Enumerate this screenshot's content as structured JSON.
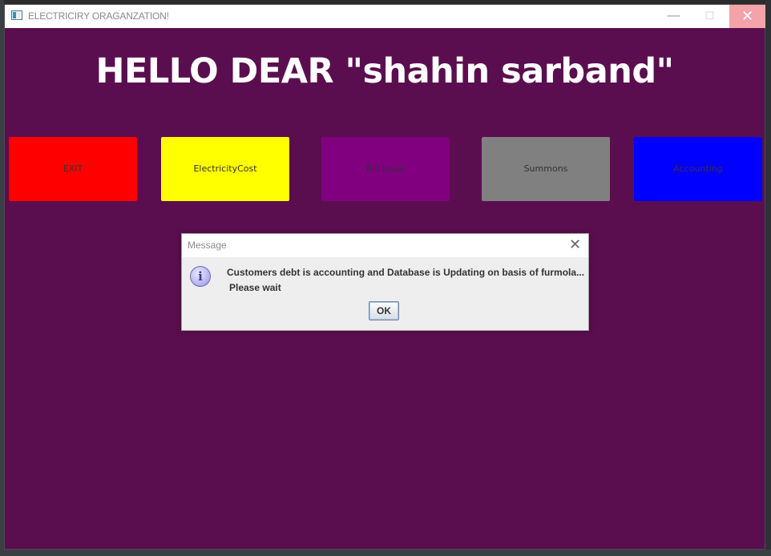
{
  "window": {
    "title": "ELECTRICIRY ORAGANZATION!",
    "controls": {
      "minimize": "—",
      "maximize": "☐",
      "close": "✕"
    }
  },
  "main": {
    "greeting": "HELLO DEAR \"shahin sarband\"",
    "buttons": [
      {
        "label": "EXIT",
        "color": "#ff0000"
      },
      {
        "label": "ElectricityCost",
        "color": "#ffff00"
      },
      {
        "label": "Bill issue",
        "color": "#800080"
      },
      {
        "label": "Summons",
        "color": "#808080"
      },
      {
        "label": "Accounting",
        "color": "#0000ff"
      }
    ]
  },
  "dialog": {
    "title": "Message",
    "icon": "info-icon",
    "message_line1": "Customers debt is accounting and Database is Updating on basis of furmola...",
    "message_line2": "Please wait",
    "ok_label": "OK"
  }
}
